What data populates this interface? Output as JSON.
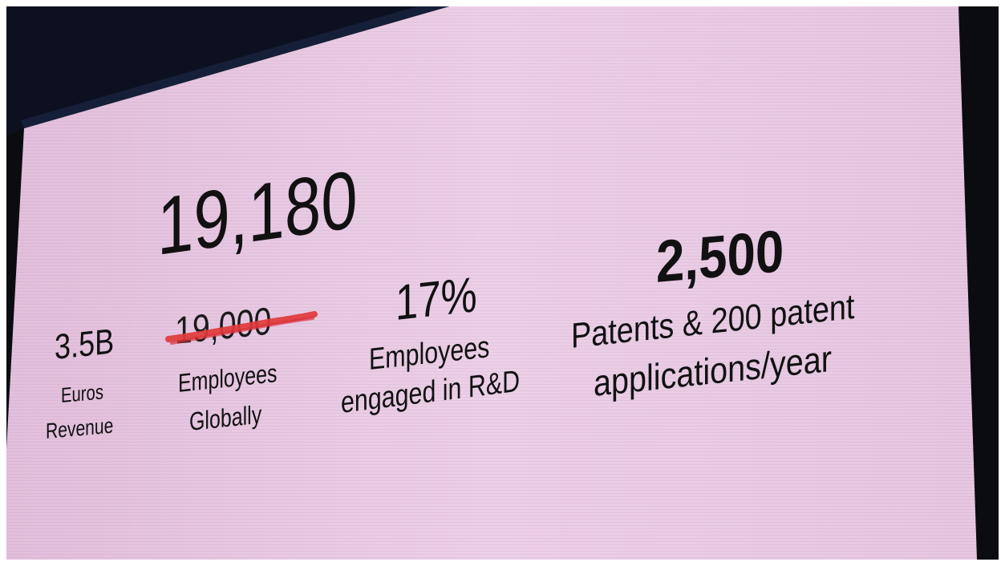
{
  "slide": {
    "revenue": {
      "value": "3.5B",
      "label_line1": "Euros",
      "label_line2": "Revenue"
    },
    "employees": {
      "value": "19,180",
      "old_value": "19,000",
      "label_line1": "Employees",
      "label_line2": "Globally"
    },
    "rnd": {
      "value": "17%",
      "label_line1": "Employees",
      "label_line2": "engaged in R&D"
    },
    "patents": {
      "value": "2,500",
      "label_line1": "Patents & 200 patent",
      "label_line2": "applications/year"
    }
  },
  "colors": {
    "screen": "#e9c9e3",
    "text": "#111111",
    "strike": "#e03a3a",
    "dark_surround": "#0b0c10"
  }
}
